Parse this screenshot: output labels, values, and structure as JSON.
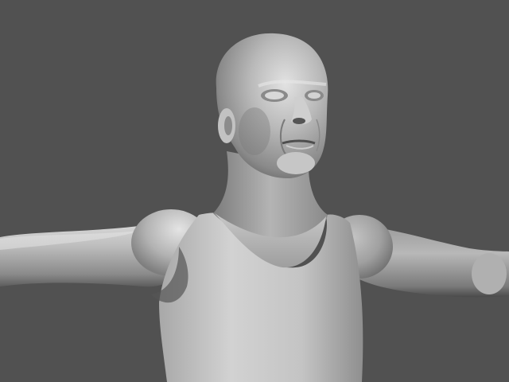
{
  "viewport": {
    "content": "3d-sculpt-model",
    "background_color": "#515151",
    "material_base_color": "#b4b4b4",
    "material_highlight_color": "#f2f2f2",
    "material_shadow_color": "#3a3a3a"
  }
}
